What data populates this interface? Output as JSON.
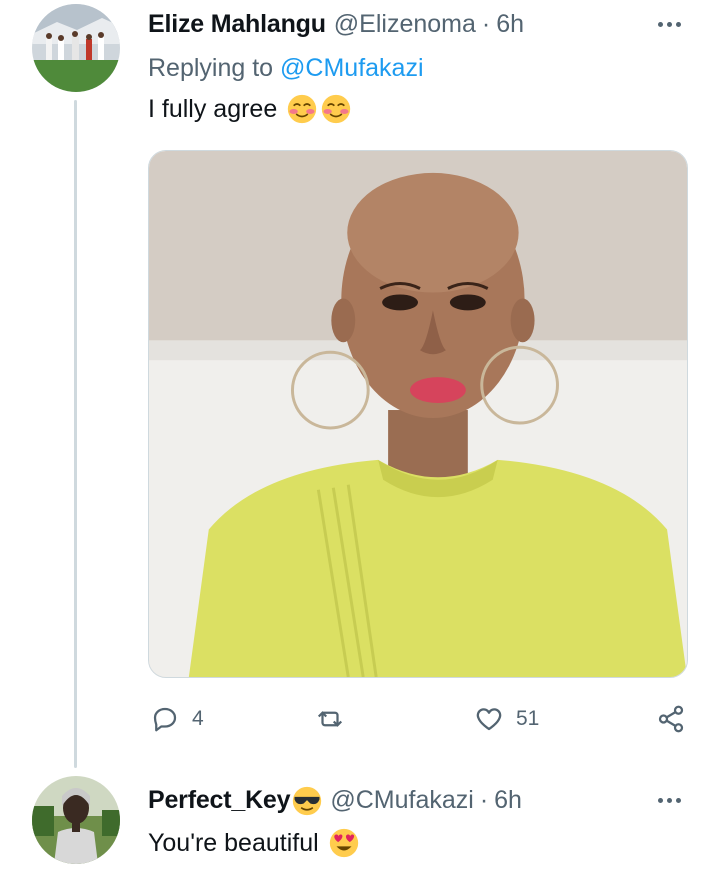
{
  "main_tweet": {
    "display_name": "Elize Mahlangu",
    "handle": "@Elizenoma",
    "separator": "·",
    "time": "6h",
    "replying_prefix": "Replying to ",
    "replying_to": "@CMufakazi",
    "text": "I fully agree",
    "text_emojis": [
      "smiling-blushing-face-emoji",
      "smiling-blushing-face-emoji"
    ],
    "stats": {
      "replies": "4",
      "likes": "51"
    }
  },
  "reply_tweet": {
    "display_name": "Perfect_Key",
    "name_emoji": "sunglasses-face-emoji",
    "handle": "@CMufakazi",
    "separator": "·",
    "time": "6h",
    "text": "You're beautiful",
    "text_emoji": "heart-eyes-face-emoji"
  },
  "colors": {
    "accent": "#1d9bf0",
    "secondary_text": "#536471",
    "thread_line": "#cfd9de"
  }
}
